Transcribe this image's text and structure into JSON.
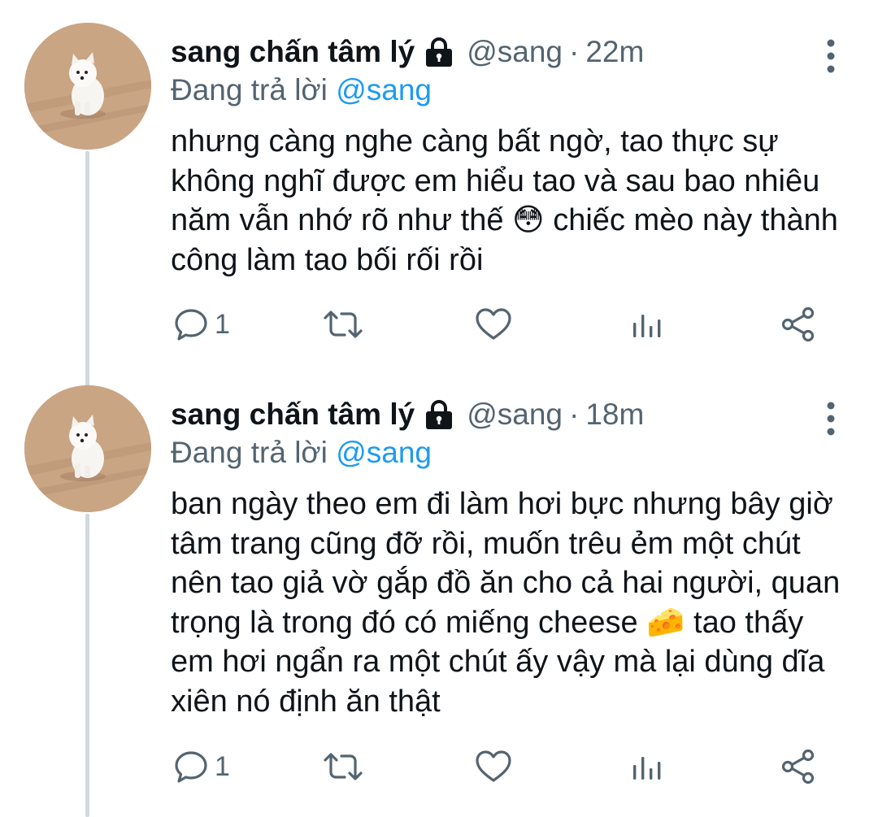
{
  "tweets": [
    {
      "display_name": "sang chấn tâm lý",
      "handle": "@sang",
      "dot": "·",
      "time": "22m",
      "reply_prefix": "Đang trả lời",
      "reply_to": "@sang",
      "text": "nhưng càng nghe càng bất ngờ, tao thực sự không nghĩ được em hiểu tao và sau bao nhiêu năm vẫn nhớ rõ như thế 😳 chiếc mèo này thành công làm tao bối rối rồi",
      "reply_count": "1",
      "icons": [
        "reply-icon",
        "retweet-icon",
        "like-icon",
        "analytics-icon",
        "share-icon"
      ]
    },
    {
      "display_name": "sang chấn tâm lý",
      "handle": "@sang",
      "dot": "·",
      "time": "18m",
      "reply_prefix": "Đang trả lời",
      "reply_to": "@sang",
      "text": "ban ngày theo em đi làm hơi bực nhưng bây giờ tâm trang cũng đỡ rồi, muốn trêu ẻm một chút nên tao giả vờ gắp đồ ăn cho cả hai người, quan trọng là trong đó có miếng cheese 🧀 tao thấy em hơi ngẩn ra một chút ấy vậy mà lại dùng dĩa xiên nó định ăn thật",
      "reply_count": "1",
      "icons": [
        "reply-icon",
        "retweet-icon",
        "like-icon",
        "analytics-icon",
        "share-icon"
      ]
    }
  ],
  "colors": {
    "text": "#0f1419",
    "secondary": "#536471",
    "mention": "#1d9bf0",
    "thread_line": "#cfd9de"
  }
}
